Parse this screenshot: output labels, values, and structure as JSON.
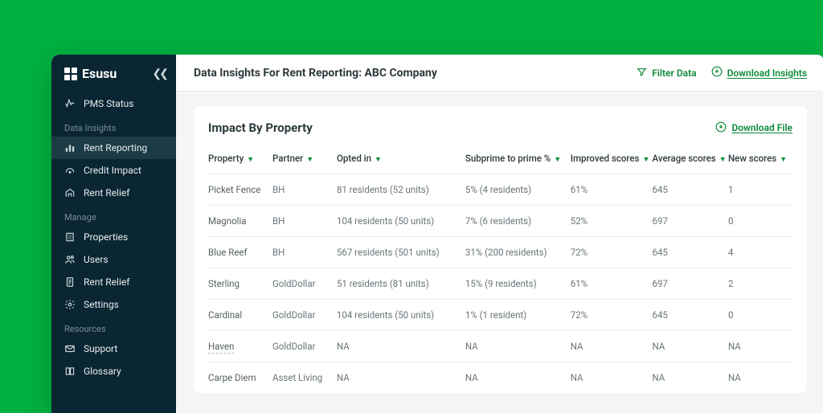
{
  "brand": "Esusu",
  "sidebar": {
    "items": [
      {
        "label": "PMS Status",
        "icon": "status"
      }
    ],
    "sections": [
      {
        "heading": "Data Insights",
        "items": [
          {
            "label": "Rent Reporting",
            "icon": "bars",
            "active": true
          },
          {
            "label": "Credit Impact",
            "icon": "gauge"
          },
          {
            "label": "Rent Relief",
            "icon": "relief"
          }
        ]
      },
      {
        "heading": "Manage",
        "items": [
          {
            "label": "Properties",
            "icon": "building"
          },
          {
            "label": "Users",
            "icon": "users"
          },
          {
            "label": "Rent Relief",
            "icon": "doc"
          },
          {
            "label": "Settings",
            "icon": "gear"
          }
        ]
      },
      {
        "heading": "Resources",
        "items": [
          {
            "label": "Support",
            "icon": "mail"
          },
          {
            "label": "Glossary",
            "icon": "book"
          }
        ]
      }
    ]
  },
  "header": {
    "title_prefix": "Data Insights For Rent Reporting: ",
    "company": "ABC Company",
    "filter_label": "Filter Data",
    "download_label": "Download Insights"
  },
  "card": {
    "title": "Impact By Property",
    "download_label": "Download File",
    "columns": [
      "Property",
      "Partner",
      "Opted in",
      "Subprime to prime %",
      "Improved scores",
      "Average scores",
      "New scores"
    ],
    "rows": [
      {
        "property": "Picket Fence",
        "partner": "BH",
        "opted": "81 residents (52 units)",
        "subprime": "5% (4 residents)",
        "improved": "61%",
        "avg": "645",
        "new": "1"
      },
      {
        "property": "Magnolia",
        "partner": "BH",
        "opted": "104 residents (50 units)",
        "subprime": "7% (6 residents)",
        "improved": "52%",
        "avg": "697",
        "new": "0"
      },
      {
        "property": "Blue Reef",
        "partner": "BH",
        "opted": "567 residents (501 units)",
        "subprime": "31% (200 residents)",
        "improved": "72%",
        "avg": "645",
        "new": "4"
      },
      {
        "property": "Sterling",
        "partner": "GoldDollar",
        "opted": "51 residents (81 units)",
        "subprime": "15% (9 residents)",
        "improved": "61%",
        "avg": "697",
        "new": "2"
      },
      {
        "property": "Cardinal",
        "partner": "GoldDollar",
        "opted": "104 residents (50 units)",
        "subprime": "1% (1 resident)",
        "improved": "72%",
        "avg": "645",
        "new": "0"
      },
      {
        "property": "Haven",
        "partner": "GoldDollar",
        "opted": "NA",
        "subprime": "NA",
        "improved": "NA",
        "avg": "NA",
        "new": "NA",
        "dashed": true
      },
      {
        "property": "Carpe Diem",
        "partner": "Asset Living",
        "opted": "NA",
        "subprime": "NA",
        "improved": "NA",
        "avg": "NA",
        "new": "NA"
      }
    ]
  }
}
